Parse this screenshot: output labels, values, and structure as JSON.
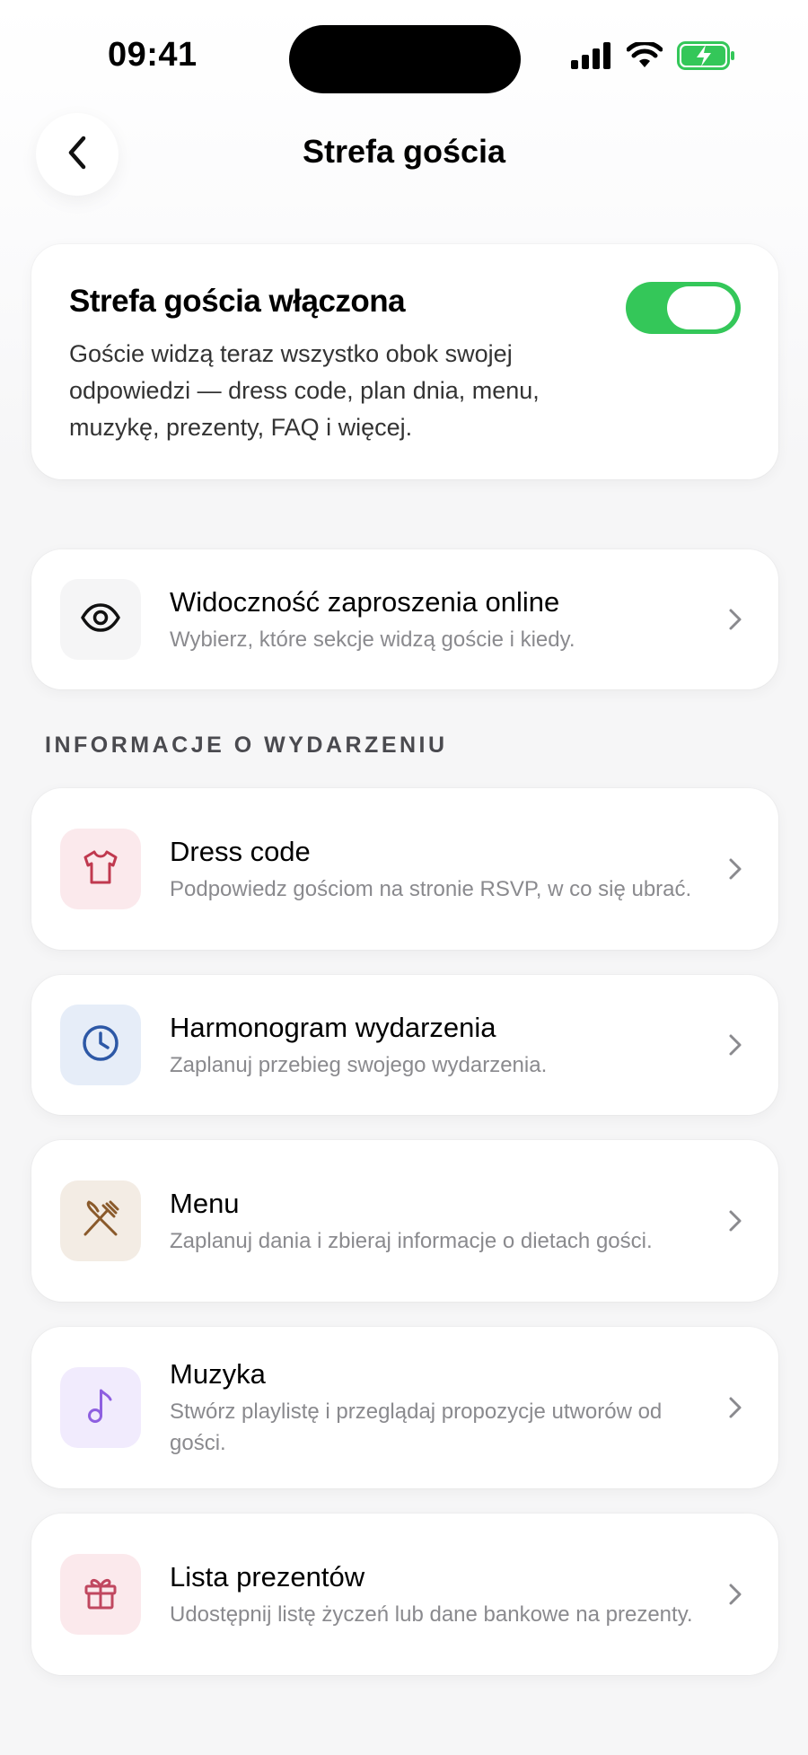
{
  "status_bar": {
    "time": "09:41",
    "icons": [
      "signal-icon",
      "wifi-icon",
      "battery-charging-icon"
    ]
  },
  "header": {
    "title": "Strefa gościa",
    "back_icon": "chevron-left-icon"
  },
  "guest_zone": {
    "title": "Strefa gościa włączona",
    "description": "Goście widzą teraz wszystko obok swojej odpowiedzi — dress code, plan dnia, menu, muzykę, prezenty, FAQ i więcej.",
    "toggle_on": true,
    "toggle_color": "#34c759"
  },
  "visibility": {
    "title": "Widoczność zaproszenia online",
    "subtitle": "Wybierz, które sekcje widzą goście i kiedy.",
    "icon": "eye-icon"
  },
  "section": {
    "label": "INFORMACJE O WYDARZENIU"
  },
  "items": [
    {
      "title": "Dress code",
      "subtitle": "Podpowiedz gościom na stronie RSVP, w co się ubrać.",
      "icon": "shirt-icon",
      "icon_color": "#c0394f",
      "icon_bg": "#fbe9ec"
    },
    {
      "title": "Harmonogram wydarzenia",
      "subtitle": "Zaplanuj przebieg swojego wydarzenia.",
      "icon": "clock-icon",
      "icon_color": "#2d58a6",
      "icon_bg": "#e6edf8"
    },
    {
      "title": "Menu",
      "subtitle": "Zaplanuj dania i zbieraj informacje o dietach gości.",
      "icon": "utensils-icon",
      "icon_color": "#8a5a2b",
      "icon_bg": "#f3ece4"
    },
    {
      "title": "Muzyka",
      "subtitle": "Stwórz playlistę i przeglądaj propozycje utworów od gości.",
      "icon": "music-note-icon",
      "icon_color": "#8e5fe0",
      "icon_bg": "#f1ebfd"
    },
    {
      "title": "Lista prezentów",
      "subtitle": "Udostępnij listę życzeń lub dane bankowe na prezenty.",
      "icon": "gift-icon",
      "icon_color": "#c0475f",
      "icon_bg": "#fbe9ec"
    }
  ]
}
